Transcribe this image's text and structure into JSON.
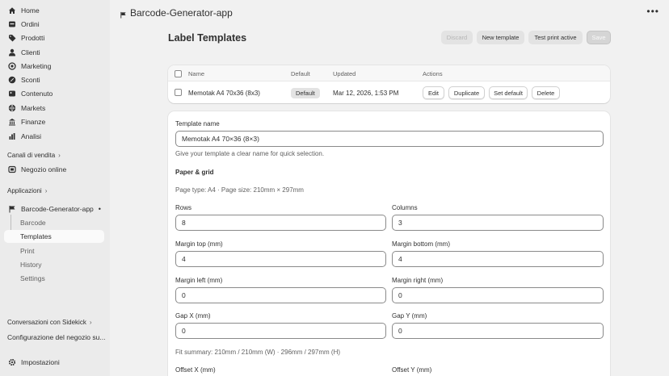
{
  "sidebar": {
    "nav": [
      {
        "label": "Home",
        "icon": "home-icon"
      },
      {
        "label": "Ordini",
        "icon": "orders-icon"
      },
      {
        "label": "Prodotti",
        "icon": "tag-icon"
      },
      {
        "label": "Clienti",
        "icon": "person-icon"
      },
      {
        "label": "Marketing",
        "icon": "target-icon"
      },
      {
        "label": "Sconti",
        "icon": "discount-icon"
      },
      {
        "label": "Contenuto",
        "icon": "content-icon"
      },
      {
        "label": "Markets",
        "icon": "globe-icon"
      },
      {
        "label": "Finanze",
        "icon": "bank-icon"
      },
      {
        "label": "Analisi",
        "icon": "chart-icon"
      }
    ],
    "sales_channels_label": "Canali di vendita",
    "online_store_label": "Negozio online",
    "apps_label": "Applicazioni",
    "app_name": "Barcode-Generator-app",
    "app_subitems": [
      "Barcode",
      "Templates",
      "Print",
      "History",
      "Settings"
    ],
    "sidekick_label": "Conversazioni con Sidekick",
    "config_label": "Configurazione del negozio su...",
    "settings_label": "Impostazioni"
  },
  "header": {
    "app_title": "Barcode-Generator-app",
    "more_glyph": "•••"
  },
  "page": {
    "title": "Label Templates",
    "buttons": {
      "discard": "Discard",
      "new_template": "New template",
      "test_print": "Test print active",
      "save": "Save"
    }
  },
  "table": {
    "headers": {
      "name": "Name",
      "default": "Default",
      "updated": "Updated",
      "actions": "Actions"
    },
    "rows": [
      {
        "name": "Memotak A4 70x36 (8x3)",
        "default_badge": "Default",
        "updated": "Mar 12, 2026, 1:53 PM",
        "actions": [
          "Edit",
          "Duplicate",
          "Set default",
          "Delete"
        ]
      }
    ]
  },
  "form": {
    "template_name_label": "Template name",
    "template_name_value": "Memotak A4 70×36 (8×3)",
    "template_name_hint": "Give your template a clear name for quick selection.",
    "paper_grid_heading": "Paper & grid",
    "page_info": "Page type: A4 · Page size: 210mm × 297mm",
    "rows_label": "Rows",
    "rows_value": "8",
    "columns_label": "Columns",
    "columns_value": "3",
    "margin_top_label": "Margin top (mm)",
    "margin_top_value": "4",
    "margin_bottom_label": "Margin bottom (mm)",
    "margin_bottom_value": "4",
    "margin_left_label": "Margin left (mm)",
    "margin_left_value": "0",
    "margin_right_label": "Margin right (mm)",
    "margin_right_value": "0",
    "gap_x_label": "Gap X (mm)",
    "gap_x_value": "0",
    "gap_y_label": "Gap Y (mm)",
    "gap_y_value": "0",
    "fit_summary": "Fit summary: 210mm / 210mm (W) · 296mm / 297mm (H)",
    "offset_x_label": "Offset X (mm)",
    "offset_y_label": "Offset Y (mm)"
  }
}
